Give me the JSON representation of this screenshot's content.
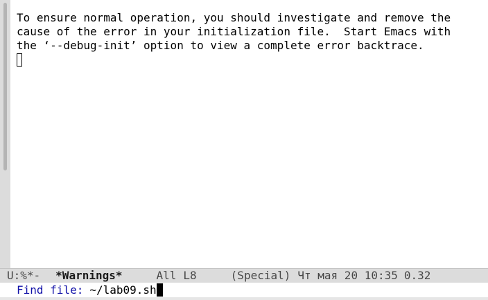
{
  "buffer": {
    "lines": [
      "To ensure normal operation, you should investigate and remove the",
      "cause of the error in your initialization file.  Start Emacs with",
      "the ‘--debug-init’ option to view a complete error backtrace."
    ]
  },
  "mode_line": {
    "status": "U:%*-",
    "buffer_name": "*Warnings*",
    "position": "All",
    "line": "L8",
    "mode": "(Special)",
    "datetime": "Чт мая 20 10:35",
    "load": "0.32"
  },
  "minibuffer": {
    "prompt": "Find file:",
    "value": "~/lab09.sh"
  }
}
